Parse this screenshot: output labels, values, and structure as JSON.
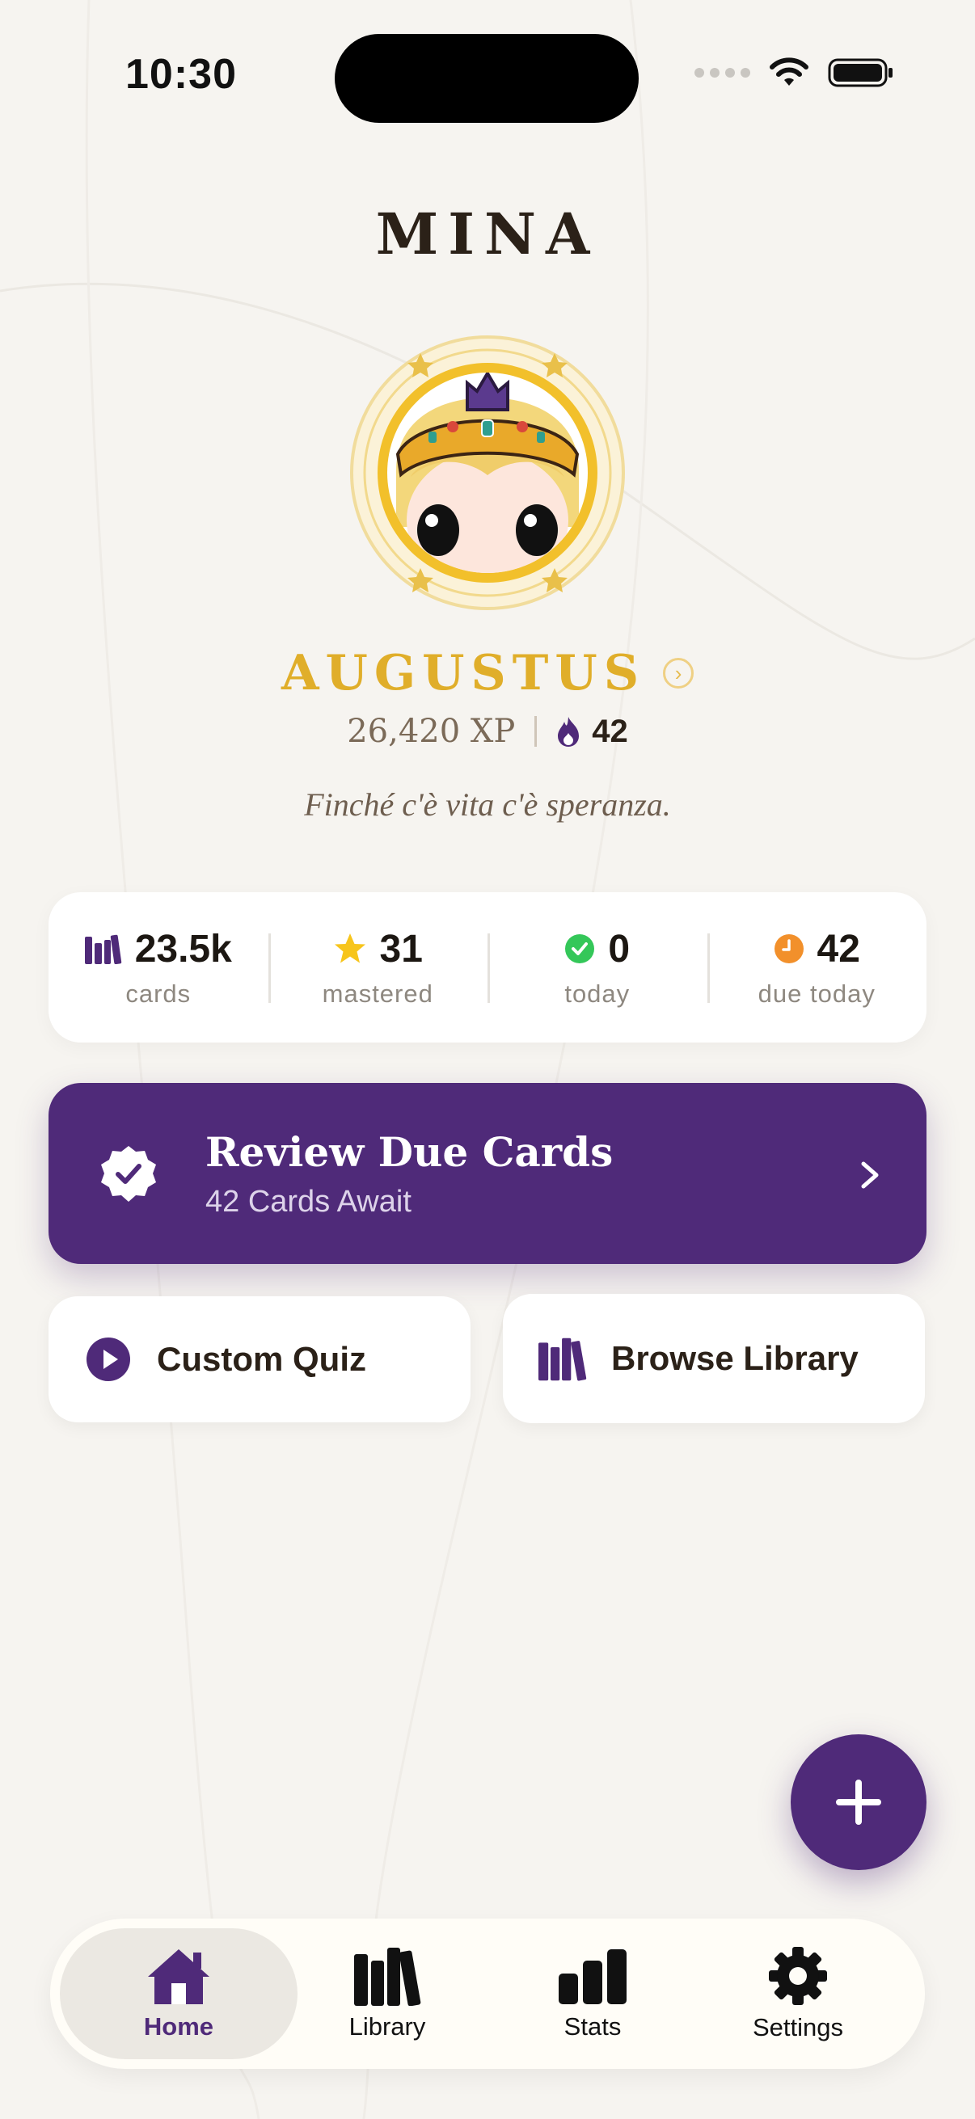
{
  "status_bar": {
    "time": "10:30"
  },
  "header": {
    "title": "MINA"
  },
  "profile": {
    "rank": "AUGUSTUS",
    "xp": "26,420 XP",
    "streak": "42",
    "quote": "Finché c'è vita c'è speranza."
  },
  "stats": [
    {
      "value": "23.5k",
      "label": "cards",
      "icon": "books-icon"
    },
    {
      "value": "31",
      "label": "mastered",
      "icon": "star-icon"
    },
    {
      "value": "0",
      "label": "today",
      "icon": "check-circle-icon"
    },
    {
      "value": "42",
      "label": "due today",
      "icon": "clock-icon"
    }
  ],
  "review": {
    "title": "Review Due Cards",
    "subtitle": "42 Cards Await"
  },
  "actions": {
    "quiz_label": "Custom Quiz",
    "library_label": "Browse Library"
  },
  "tabs": [
    {
      "label": "Home",
      "icon": "house-icon",
      "active": true
    },
    {
      "label": "Library",
      "icon": "books-icon",
      "active": false
    },
    {
      "label": "Stats",
      "icon": "bar-chart-icon",
      "active": false
    },
    {
      "label": "Settings",
      "icon": "gear-icon",
      "active": false
    }
  ],
  "colors": {
    "background": "#f6f4f0",
    "accent_purple": "#4f2a79",
    "gold": "#e0ae2a",
    "text_dark": "#2b2118",
    "success_green": "#34c759",
    "warning_orange": "#f2902b",
    "star_yellow": "#f7c51c"
  }
}
